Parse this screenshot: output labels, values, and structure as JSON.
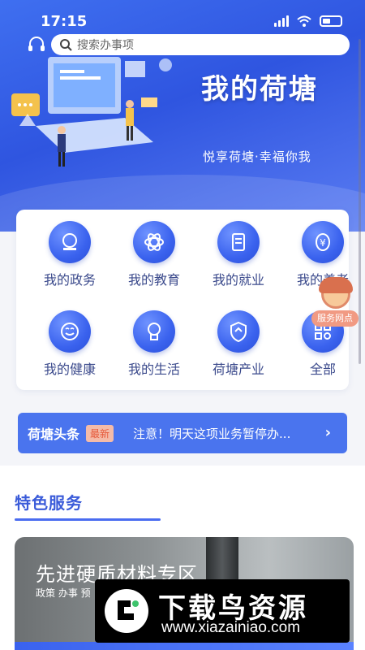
{
  "status_bar": {
    "time": "17:15"
  },
  "search": {
    "placeholder": "搜索办事项"
  },
  "hero": {
    "title": "我的荷塘",
    "subtitle": "悦享荷塘·幸福你我"
  },
  "grid": [
    {
      "label": "我的政务",
      "icon": "stamp-icon"
    },
    {
      "label": "我的教育",
      "icon": "atom-icon"
    },
    {
      "label": "我的就业",
      "icon": "document-icon"
    },
    {
      "label": "我的养老",
      "icon": "yen-icon"
    },
    {
      "label": "我的健康",
      "icon": "smile-icon"
    },
    {
      "label": "我的生活",
      "icon": "lightbulb-icon"
    },
    {
      "label": "荷塘产业",
      "icon": "shield-icon"
    },
    {
      "label": "全部",
      "icon": "grid-icon"
    }
  ],
  "service_point": {
    "label": "服务网点"
  },
  "news": {
    "title": "荷塘头条",
    "badge": "最新",
    "text": "注意！明天这项业务暂停办..."
  },
  "featured": {
    "section_title": "特色服务",
    "card_title": "先进硬质材料专区",
    "card_subtitle": "政策 办事 预"
  },
  "watermark": {
    "title": "下载鸟资源",
    "url": "www.xiazainiao.com"
  },
  "colors": {
    "primary": "#3a62ee",
    "accent": "#4a74ee",
    "badge": "#e65a3a"
  }
}
